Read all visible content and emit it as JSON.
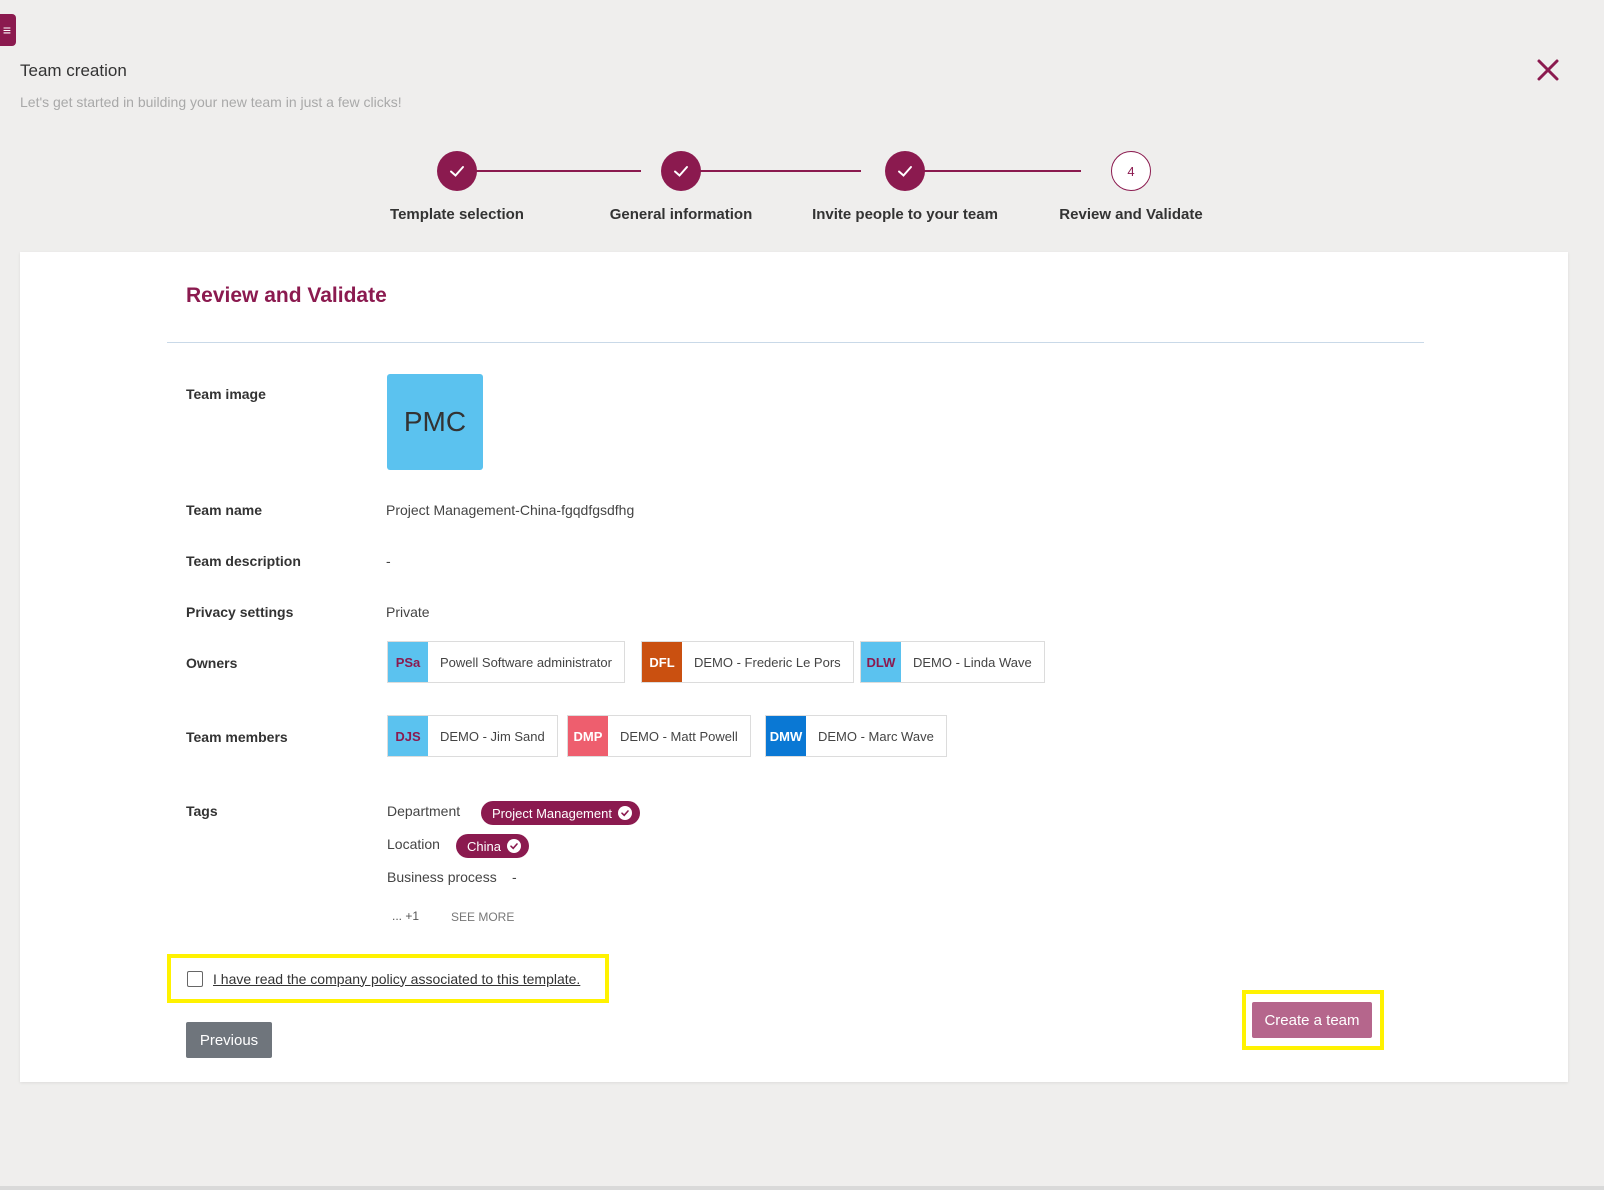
{
  "header": {
    "menu_icon_glyph": "≡",
    "title": "Team creation",
    "subtitle": "Let's get started in building your new team in just a few clicks!"
  },
  "stepper": {
    "steps": [
      {
        "label": "Template selection",
        "state": "done"
      },
      {
        "label": "General information",
        "state": "done"
      },
      {
        "label": "Invite people to your team",
        "state": "done"
      },
      {
        "label": "Review and Validate",
        "state": "current",
        "number": "4"
      }
    ]
  },
  "review": {
    "title": "Review and Validate",
    "team_image": {
      "label": "Team image",
      "initials": "PMC"
    },
    "team_name": {
      "label": "Team name",
      "value": "Project Management-China-fgqdfgsdfhg"
    },
    "team_description": {
      "label": "Team description",
      "value": "-"
    },
    "privacy": {
      "label": "Privacy settings",
      "value": "Private"
    },
    "owners": {
      "label": "Owners",
      "people": [
        {
          "initials": "PSa",
          "name": "Powell Software administrator",
          "bg": "#5bc2ef",
          "fg": "#8b1a4f"
        },
        {
          "initials": "DFL",
          "name": "DEMO - Frederic Le Pors",
          "bg": "#ca5010",
          "fg": "#ffffff"
        },
        {
          "initials": "DLW",
          "name": "DEMO - Linda Wave",
          "bg": "#5bc2ef",
          "fg": "#8b1a4f"
        }
      ]
    },
    "members": {
      "label": "Team members",
      "people": [
        {
          "initials": "DJS",
          "name": "DEMO - Jim Sand",
          "bg": "#5bc2ef",
          "fg": "#8b1a4f"
        },
        {
          "initials": "DMP",
          "name": "DEMO - Matt Powell",
          "bg": "#ee5e6e",
          "fg": "#ffffff"
        },
        {
          "initials": "DMW",
          "name": "DEMO - Marc Wave",
          "bg": "#0a78d4",
          "fg": "#ffffff"
        }
      ]
    },
    "tags": {
      "label": "Tags",
      "items": [
        {
          "name": "Department",
          "value": "Project Management"
        },
        {
          "name": "Location",
          "value": "China"
        },
        {
          "name": "Business process",
          "value": "-"
        }
      ],
      "more_count": "... +1",
      "see_more": "SEE MORE"
    },
    "policy_checkbox": {
      "label": "I have read the company policy associated to this template.",
      "checked": false
    },
    "buttons": {
      "previous": "Previous",
      "create": "Create a team"
    }
  },
  "colors": {
    "brand": "#8b1a4f",
    "highlight": "#fff200",
    "create_button": "#b5668c",
    "previous_button": "#6f757c"
  }
}
